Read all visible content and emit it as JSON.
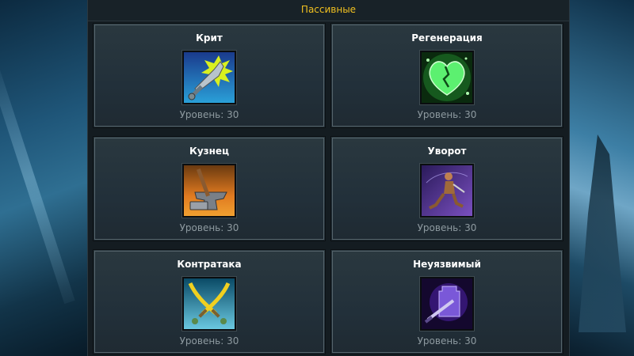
{
  "panel": {
    "title": "Пассивные"
  },
  "level_prefix": "Уровень: ",
  "skills": [
    {
      "name": "Крит",
      "level": "30",
      "icon": "sword-burst-icon"
    },
    {
      "name": "Регенерация",
      "level": "30",
      "icon": "green-heart-icon"
    },
    {
      "name": "Кузнец",
      "level": "30",
      "icon": "anvil-hammer-icon"
    },
    {
      "name": "Уворот",
      "level": "30",
      "icon": "dodging-warrior-icon"
    },
    {
      "name": "Контратака",
      "level": "30",
      "icon": "crossed-swords-icon"
    },
    {
      "name": "Неуязвимый",
      "level": "30",
      "icon": "shielded-sword-icon"
    }
  ],
  "colors": {
    "title_accent": "#f0c020",
    "card_title": "#ffffff",
    "level_text": "#8e9aa0",
    "panel_bg": "#141c21"
  }
}
